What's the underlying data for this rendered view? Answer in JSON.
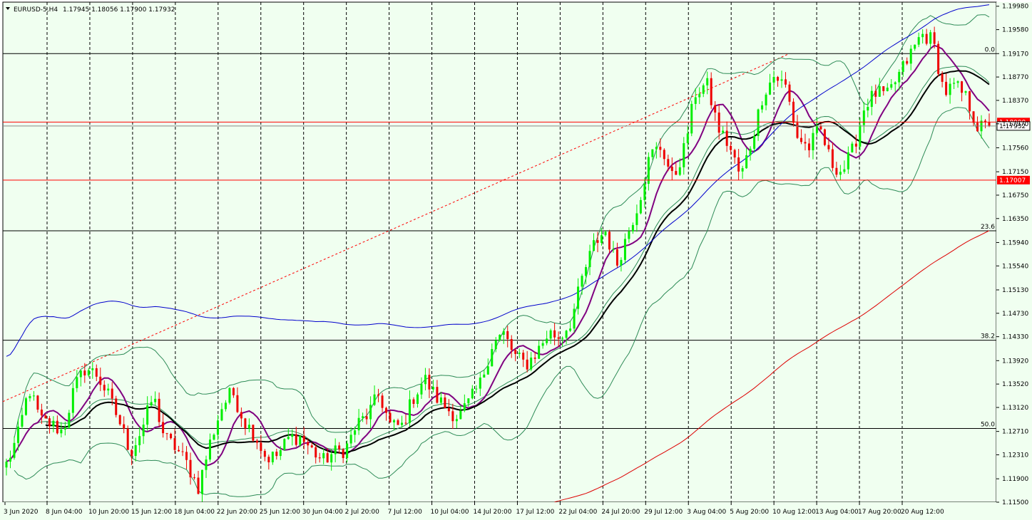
{
  "header": {
    "symbol": "EURUSD-5,H4",
    "ohlc": "1.17945 1.18056 1.17900 1.17932"
  },
  "chart_data": {
    "type": "candlestick",
    "symbol": "EURUSD-5",
    "timeframe": "H4",
    "last_ohlc": {
      "open": 1.17945,
      "high": 1.18056,
      "low": 1.179,
      "close": 1.17932
    },
    "ylim": [
      1.115,
      1.2005
    ],
    "y_ticks": [
      "1.19980",
      "1.19580",
      "1.19170",
      "1.18770",
      "1.18370",
      "1.17970",
      "1.17560",
      "1.17150",
      "1.16750",
      "1.16350",
      "1.15940",
      "1.15540",
      "1.15130",
      "1.14730",
      "1.14330",
      "1.13920",
      "1.13520",
      "1.13120",
      "1.12710",
      "1.12310",
      "1.11900",
      "1.11500"
    ],
    "x_ticks": [
      "3 Jun 2020",
      "8 Jun 04:00",
      "10 Jun 20:00",
      "15 Jun 12:00",
      "18 Jun 04:00",
      "22 Jun 20:00",
      "25 Jun 12:00",
      "30 Jun 04:00",
      "2 Jul 20:00",
      "7 Jul 12:00",
      "10 Jul 04:00",
      "14 Jul 20:00",
      "17 Jul 12:00",
      "22 Jul 04:00",
      "24 Jul 20:00",
      "29 Jul 12:00",
      "3 Aug 04:00",
      "5 Aug 20:00",
      "10 Aug 12:00",
      "13 Aug 04:00",
      "17 Aug 20:00",
      "20 Aug 12:00"
    ],
    "horizontal_levels": [
      {
        "price": 1.18,
        "label": "1.18000",
        "color": "#ff0000"
      },
      {
        "price": 1.17007,
        "label": "1.17007",
        "color": "#ff0000"
      }
    ],
    "fibonacci": [
      {
        "label": "0.0",
        "price": 1.1917
      },
      {
        "label": "23.6",
        "price": 1.1614
      },
      {
        "label": "38.2",
        "price": 1.1427
      },
      {
        "label": "50.0",
        "price": 1.1276
      }
    ],
    "current_price": {
      "price": 1.17932,
      "label": "1.17932"
    },
    "price_path": [
      1.1215,
      1.1262,
      1.1345,
      1.129,
      1.1283,
      1.127,
      1.1345,
      1.138,
      1.1368,
      1.1333,
      1.1288,
      1.1235,
      1.1275,
      1.1332,
      1.126,
      1.1243,
      1.1215,
      1.1175,
      1.125,
      1.131,
      1.134,
      1.129,
      1.1265,
      1.1225,
      1.123,
      1.126,
      1.1262,
      1.124,
      1.122,
      1.1235,
      1.124,
      1.1282,
      1.13,
      1.1335,
      1.128,
      1.128,
      1.1328,
      1.1362,
      1.133,
      1.131,
      1.1295,
      1.1322,
      1.1355,
      1.142,
      1.1438,
      1.14,
      1.1385,
      1.1408,
      1.144,
      1.1432,
      1.146,
      1.1535,
      1.159,
      1.1615,
      1.1555,
      1.161,
      1.1665,
      1.1745,
      1.1758,
      1.17,
      1.1755,
      1.185,
      1.1865,
      1.179,
      1.1758,
      1.1705,
      1.177,
      1.185,
      1.188,
      1.186,
      1.1775,
      1.1755,
      1.179,
      1.173,
      1.1715,
      1.1755,
      1.183,
      1.185,
      1.1845,
      1.188,
      1.1915,
      1.195,
      1.194,
      1.185,
      1.1862,
      1.184,
      1.179,
      1.1793
    ],
    "colors": {
      "background": "#f0fff0",
      "bull_candle": "#00ee00",
      "bear_candle": "#ee0000",
      "bollinger": "#2e8b57",
      "ma_fast": "#800080",
      "ma_slow": "#000000",
      "ma_blue": "#0000cc",
      "ma_red": "#dd0000",
      "trendline": "#ff0000",
      "grid": "#000000"
    }
  }
}
